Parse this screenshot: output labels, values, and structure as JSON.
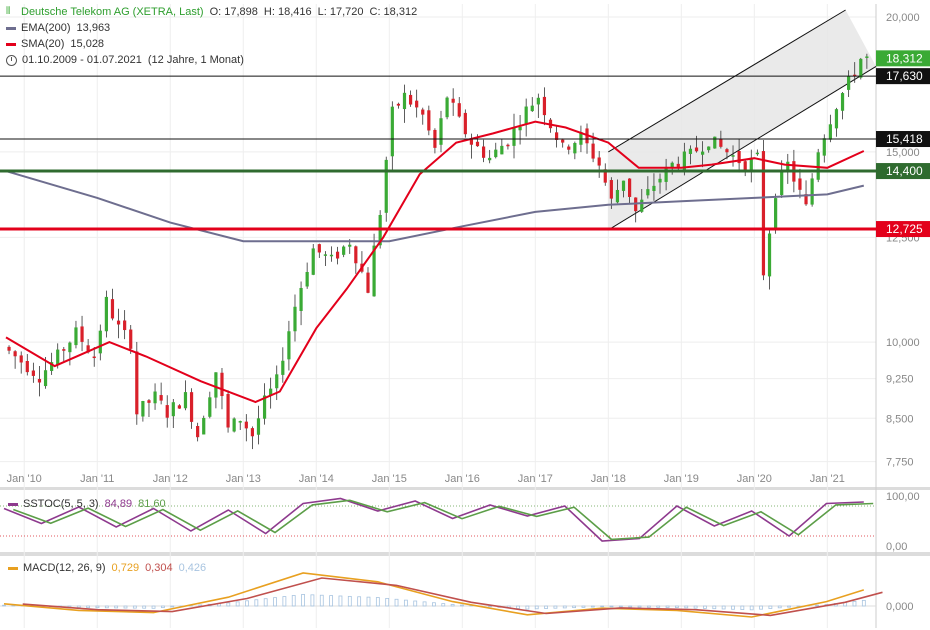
{
  "header": {
    "title": "Deutsche Telekom AG (XETRA, Last)",
    "ohlc": {
      "O": "O: 17,898",
      "H": "H: 18,416",
      "L": "L: 17,720",
      "C": "C: 18,312"
    },
    "ema_label": "EMA(200)",
    "ema_value": "13,963",
    "sma_label": "SMA(20)",
    "sma_value": "15,028",
    "range_label": "01.10.2009 - 01.07.2021",
    "range_detail": "(12 Jahre, 1 Monat)"
  },
  "sstoc_legend": {
    "label": "SSTOC(5, 5, 3)",
    "v1": "84,89",
    "v2": "81,60"
  },
  "macd_legend": {
    "label": "MACD(12, 26, 9)",
    "v1": "0,729",
    "v2": "0,304",
    "v3": "0,426"
  },
  "colors": {
    "up": "#3aaa35",
    "down": "#d9202a",
    "ema": "#6e6e8f",
    "sma": "#e3001b",
    "support_green": "#2f6b2f",
    "support_red": "#e3001b",
    "stoch_k": "#8e3a8e",
    "stoch_d": "#5c9e48",
    "macd": "#e8a020",
    "signal": "#c0504d",
    "hist": "#a8c4e0"
  },
  "chart_data": [
    {
      "type": "candlestick",
      "title": "Deutsche Telekom AG (XETRA, Last)",
      "x_range": [
        "2009-10",
        "2021-07"
      ],
      "x_ticks": [
        "Jan '10",
        "Jan '11",
        "Jan '12",
        "Jan '13",
        "Jan '14",
        "Jan '15",
        "Jan '16",
        "Jan '17",
        "Jan '18",
        "Jan '19",
        "Jan '20",
        "Jan '21"
      ],
      "y_scale": "log",
      "y_ticks": [
        "7,750",
        "8,500",
        "9,250",
        "10,000",
        "12,500",
        "15,000",
        "20,000"
      ],
      "ylim": [
        7.5,
        20.3
      ],
      "price_path": [
        [
          "2009-10",
          9.9
        ],
        [
          "2010-01",
          9.6
        ],
        [
          "2010-04",
          9.3
        ],
        [
          "2010-07",
          9.7
        ],
        [
          "2010-10",
          10.2
        ],
        [
          "2011-01",
          9.7
        ],
        [
          "2011-03",
          10.9
        ],
        [
          "2011-05",
          10.3
        ],
        [
          "2011-07",
          10.0
        ],
        [
          "2011-08",
          8.6
        ],
        [
          "2011-11",
          8.9
        ],
        [
          "2012-01",
          8.6
        ],
        [
          "2012-04",
          8.9
        ],
        [
          "2012-06",
          8.2
        ],
        [
          "2012-09",
          9.4
        ],
        [
          "2012-11",
          8.3
        ],
        [
          "2013-01",
          8.5
        ],
        [
          "2013-03",
          8.2
        ],
        [
          "2013-05",
          8.8
        ],
        [
          "2013-07",
          9.2
        ],
        [
          "2013-10",
          10.8
        ],
        [
          "2014-01",
          12.2
        ],
        [
          "2014-04",
          11.9
        ],
        [
          "2014-07",
          12.4
        ],
        [
          "2014-10",
          11.2
        ],
        [
          "2014-12",
          13.2
        ],
        [
          "2015-02",
          16.3
        ],
        [
          "2015-04",
          16.9
        ],
        [
          "2015-07",
          16.2
        ],
        [
          "2015-09",
          15.1
        ],
        [
          "2015-11",
          16.9
        ],
        [
          "2016-01",
          16.0
        ],
        [
          "2016-03",
          15.3
        ],
        [
          "2016-06",
          14.8
        ],
        [
          "2016-09",
          15.4
        ],
        [
          "2016-12",
          16.4
        ],
        [
          "2017-02",
          16.9
        ],
        [
          "2017-04",
          15.9
        ],
        [
          "2017-06",
          15.1
        ],
        [
          "2017-09",
          15.5
        ],
        [
          "2017-12",
          14.6
        ],
        [
          "2018-02",
          13.5
        ],
        [
          "2018-04",
          14.2
        ],
        [
          "2018-06",
          13.2
        ],
        [
          "2018-09",
          14.0
        ],
        [
          "2018-12",
          14.6
        ],
        [
          "2019-03",
          14.9
        ],
        [
          "2019-06",
          15.4
        ],
        [
          "2019-09",
          15.0
        ],
        [
          "2019-12",
          14.6
        ],
        [
          "2020-02",
          14.8
        ],
        [
          "2020-03",
          11.6
        ],
        [
          "2020-05",
          13.8
        ],
        [
          "2020-07",
          14.6
        ],
        [
          "2020-10",
          13.3
        ],
        [
          "2020-12",
          15.1
        ],
        [
          "2021-03",
          16.6
        ],
        [
          "2021-05",
          17.4
        ],
        [
          "2021-07",
          18.3
        ]
      ],
      "ema200_path": [
        [
          "2009-10",
          14.4
        ],
        [
          "2011-01",
          13.6
        ],
        [
          "2012-01",
          12.9
        ],
        [
          "2013-01",
          12.4
        ],
        [
          "2014-01",
          12.4
        ],
        [
          "2015-01",
          12.4
        ],
        [
          "2016-01",
          12.8
        ],
        [
          "2017-01",
          13.2
        ],
        [
          "2018-01",
          13.4
        ],
        [
          "2019-01",
          13.5
        ],
        [
          "2020-01",
          13.6
        ],
        [
          "2021-01",
          13.7
        ],
        [
          "2021-07",
          13.96
        ]
      ],
      "sma20_path": [
        [
          "2009-10",
          10.1
        ],
        [
          "2010-06",
          9.5
        ],
        [
          "2011-03",
          10.0
        ],
        [
          "2011-09",
          9.7
        ],
        [
          "2012-06",
          9.2
        ],
        [
          "2013-03",
          8.8
        ],
        [
          "2013-07",
          9.0
        ],
        [
          "2014-01",
          10.3
        ],
        [
          "2014-06",
          11.2
        ],
        [
          "2014-12",
          12.5
        ],
        [
          "2015-06",
          14.3
        ],
        [
          "2015-12",
          15.3
        ],
        [
          "2016-06",
          15.6
        ],
        [
          "2017-01",
          16.0
        ],
        [
          "2017-06",
          15.8
        ],
        [
          "2018-01",
          15.3
        ],
        [
          "2018-06",
          14.5
        ],
        [
          "2019-01",
          14.5
        ],
        [
          "2019-06",
          14.6
        ],
        [
          "2020-01",
          14.8
        ],
        [
          "2020-06",
          14.6
        ],
        [
          "2021-01",
          14.5
        ],
        [
          "2021-07",
          15.03
        ]
      ],
      "horizontal_levels": [
        {
          "value": 17.63,
          "label": "17,630",
          "color": "#111111"
        },
        {
          "value": 15.418,
          "label": "15,418",
          "color": "#111111"
        },
        {
          "value": 14.4,
          "label": "14,400",
          "color": "#2f6b2f"
        },
        {
          "value": 12.725,
          "label": "12,725",
          "color": "#e3001b"
        }
      ],
      "last_price": {
        "value": 18.312,
        "label": "18,312"
      },
      "trend_channel": {
        "lower": [
          [
            "2018-01",
            12.7
          ],
          [
            "2021-09",
            18.0
          ]
        ],
        "upper": [
          [
            "2018-01",
            15.0
          ],
          [
            "2021-04",
            20.3
          ]
        ]
      }
    },
    {
      "type": "line",
      "title": "SSTOC(5, 5, 3)",
      "ylim": [
        0,
        100
      ],
      "y_ticks": [
        "0,00",
        "100,00"
      ],
      "series": [
        {
          "name": "SSTOC(5, 5, 3)",
          "values": [
            [
              0,
              75
            ],
            [
              1,
              45
            ],
            [
              2,
              78
            ],
            [
              3,
              38
            ],
            [
              4,
              75
            ],
            [
              5,
              30
            ],
            [
              6,
              72
            ],
            [
              7,
              25
            ],
            [
              8,
              85
            ],
            [
              9,
              95
            ],
            [
              10,
              70
            ],
            [
              11,
              90
            ],
            [
              12,
              55
            ],
            [
              13,
              82
            ],
            [
              14,
              60
            ],
            [
              15,
              80
            ],
            [
              16,
              10
            ],
            [
              17,
              15
            ],
            [
              18,
              80
            ],
            [
              19,
              40
            ],
            [
              20,
              70
            ],
            [
              21,
              20
            ],
            [
              22,
              85
            ],
            [
              23,
              88
            ]
          ]
        }
      ]
    },
    {
      "type": "line",
      "title": "MACD(12, 26, 9)",
      "y_ticks": [
        "0,000"
      ],
      "series": [
        {
          "name": "MACD(12, 26, 9)",
          "values": [
            [
              0,
              0.1
            ],
            [
              2,
              -0.2
            ],
            [
              4,
              -0.3
            ],
            [
              6,
              0.4
            ],
            [
              8,
              1.5
            ],
            [
              10,
              1.1
            ],
            [
              12,
              0.2
            ],
            [
              14,
              -0.4
            ],
            [
              16,
              -0.1
            ],
            [
              18,
              -0.2
            ],
            [
              20,
              -0.5
            ],
            [
              22,
              0.2
            ],
            [
              23,
              0.73
            ]
          ]
        }
      ]
    }
  ]
}
